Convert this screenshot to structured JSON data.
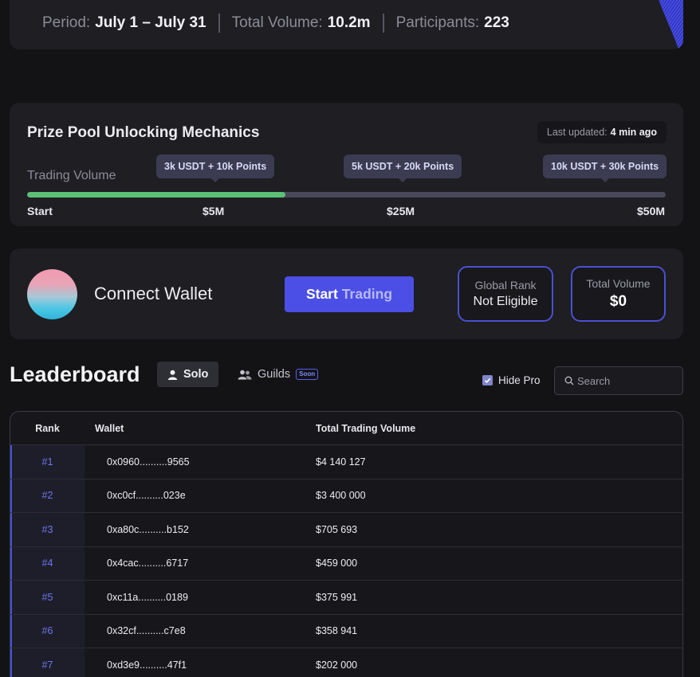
{
  "stats": {
    "period_label": "Period:",
    "period_value": "July 1 – July 31",
    "volume_label": "Total Volume:",
    "volume_value": "10.2m",
    "participants_label": "Participants:",
    "participants_value": "223"
  },
  "prize_pool": {
    "title": "Prize Pool Unlocking Mechanics",
    "updated_prefix": "Last updated:",
    "updated_value": "4 min ago",
    "volume_label": "Trading Volume",
    "progress_fraction": 0.405,
    "tiers": [
      "3k USDT + 10k Points",
      "5k USDT + 20k Points",
      "10k USDT + 30k Points"
    ],
    "milestones": [
      "Start",
      "$5M",
      "$25M",
      "$50M"
    ],
    "colors": {
      "progress": "#5bbf76",
      "track": "#48485a"
    }
  },
  "wallet": {
    "connect_label": "Connect Wallet",
    "start_label_a": "Start",
    "start_label_b": "Trading",
    "global_rank_label": "Global Rank",
    "global_rank_value": "Not Eligible",
    "total_volume_label": "Total Volume",
    "total_volume_value": "$0",
    "accent": "#4b4fe5"
  },
  "leaderboard": {
    "title": "Leaderboard",
    "tabs": {
      "solo": "Solo",
      "guilds": "Guilds",
      "soon_badge": "Soon"
    },
    "hide_pro_label": "Hide Pro",
    "hide_pro_checked": true,
    "search_placeholder": "Search",
    "columns": {
      "rank": "Rank",
      "wallet": "Wallet",
      "volume": "Total Trading Volume"
    },
    "rows": [
      {
        "rank": "#1",
        "wallet": "0x0960..........9565",
        "volume": "$4 140 127"
      },
      {
        "rank": "#2",
        "wallet": "0xc0cf..........023e",
        "volume": "$3 400 000"
      },
      {
        "rank": "#3",
        "wallet": "0xa80c..........b152",
        "volume": "$705 693"
      },
      {
        "rank": "#4",
        "wallet": "0x4cac..........6717",
        "volume": "$459 000"
      },
      {
        "rank": "#5",
        "wallet": "0xc11a..........0189",
        "volume": "$375 991"
      },
      {
        "rank": "#6",
        "wallet": "0x32cf..........c7e8",
        "volume": "$358 941"
      },
      {
        "rank": "#7",
        "wallet": "0xd3e9..........47f1",
        "volume": "$202 000"
      }
    ]
  },
  "icons": {
    "user": "user-icon",
    "users": "users-icon",
    "check": "check-icon",
    "search": "search-icon"
  }
}
